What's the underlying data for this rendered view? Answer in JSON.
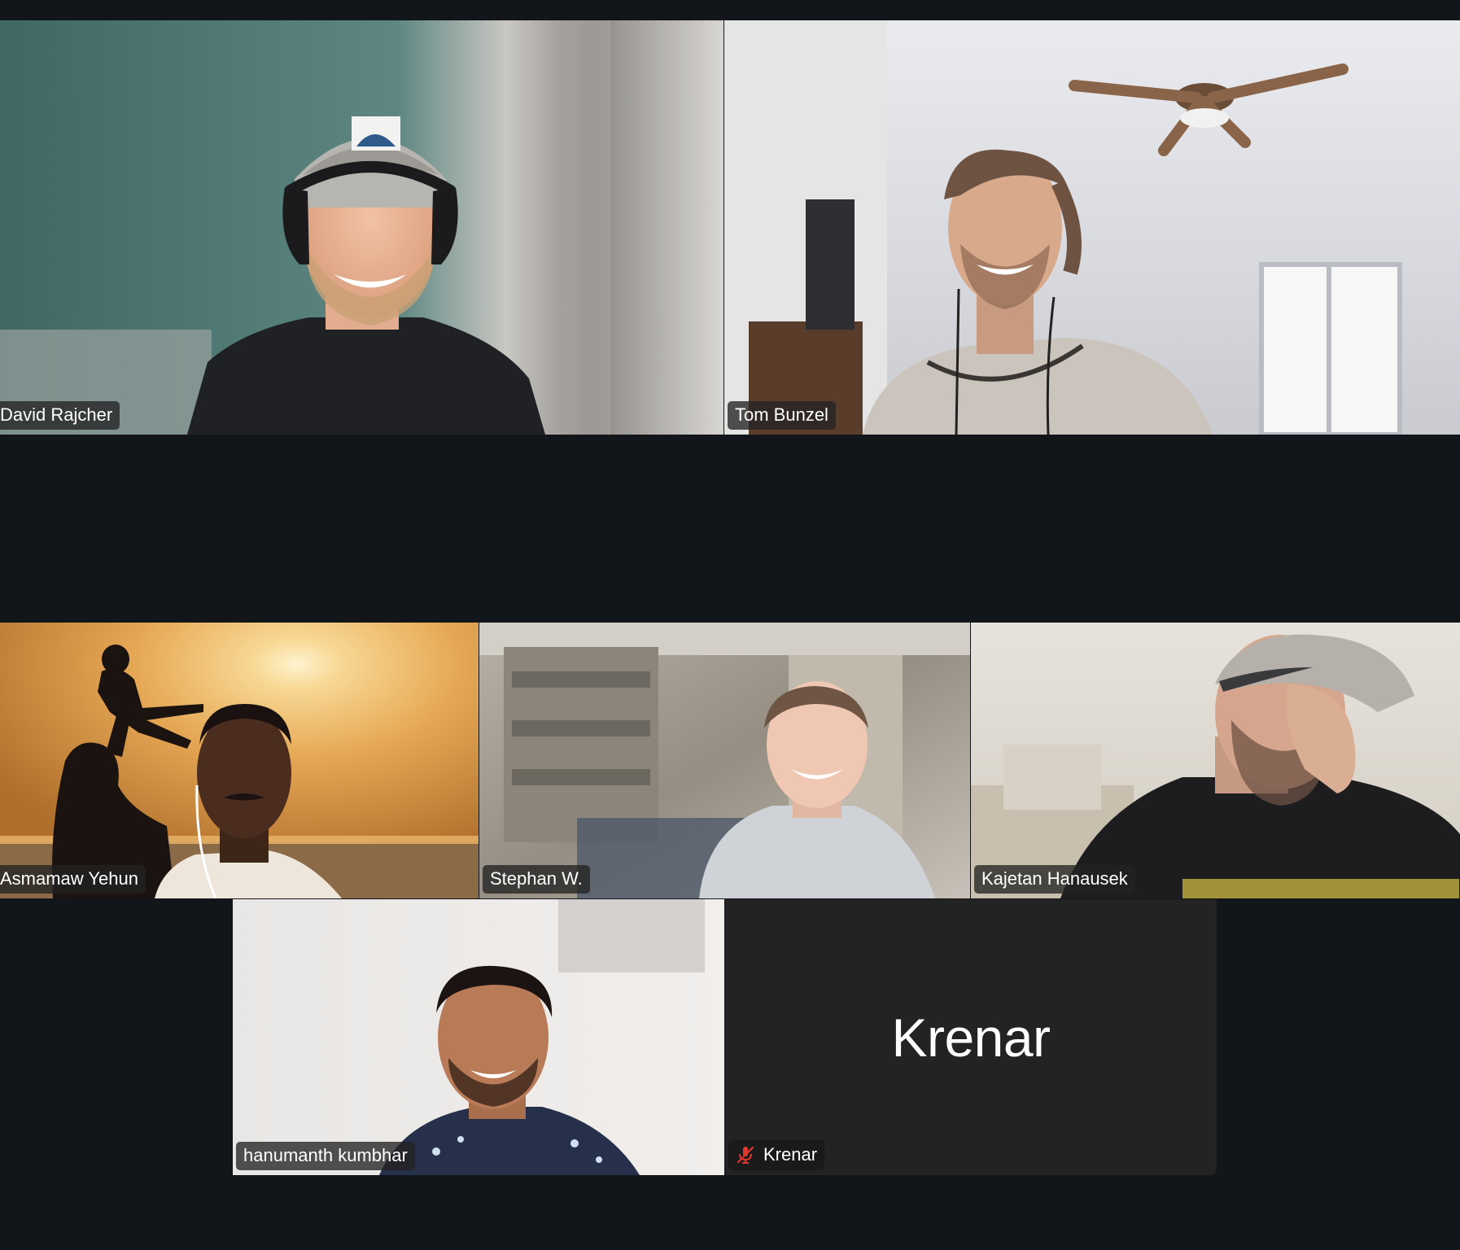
{
  "meeting": {
    "participants": [
      {
        "id": "p1",
        "name": "David Rajcher",
        "video": true
      },
      {
        "id": "p2",
        "name": "Tom Bunzel",
        "video": true
      },
      {
        "id": "p3",
        "name": "Asmamaw Yehun",
        "video": true
      },
      {
        "id": "p4",
        "name": "Stephan W.",
        "video": true
      },
      {
        "id": "p5",
        "name": "Kajetan Hanausek",
        "video": true
      },
      {
        "id": "p6",
        "name": "hanumanth kumbhar",
        "video": true
      },
      {
        "id": "p7",
        "name": "Krenar",
        "video": false,
        "muted": true,
        "display_name": "Krenar"
      }
    ]
  },
  "icons": {
    "muted": "microphone-muted-icon"
  },
  "colors": {
    "background": "#121519",
    "tile_empty": "#222222",
    "name_tag": "#222222",
    "muted_red": "#e0382f"
  }
}
